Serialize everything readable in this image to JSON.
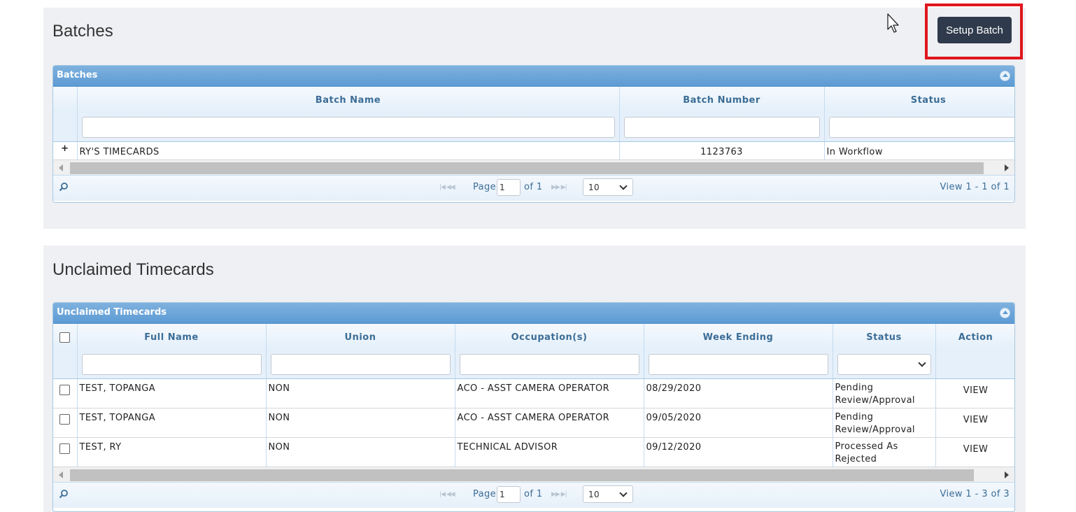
{
  "batches": {
    "title": "Batches",
    "setup_button": "Setup Batch",
    "grid": {
      "caption": "Batches",
      "columns": [
        "Batch Name",
        "Batch Number",
        "Status"
      ],
      "rows": [
        {
          "name": "RY'S TIMECARDS",
          "number": "1123763",
          "status": "In Workflow"
        }
      ],
      "pager": {
        "page_label": "Page",
        "page_value": "1",
        "of_label": "of 1",
        "page_size": "10",
        "view_summary": "View 1 - 1 of 1"
      }
    }
  },
  "unclaimed": {
    "title": "Unclaimed Timecards",
    "grid": {
      "caption": "Unclaimed Timecards",
      "columns": [
        "Full Name",
        "Union",
        "Occupation(s)",
        "Week Ending",
        "Status",
        "Action"
      ],
      "rows": [
        {
          "name": "TEST, TOPANGA",
          "union": "NON",
          "occupation": "ACO - ASST CAMERA OPERATOR",
          "week_ending": "08/29/2020",
          "status_line1": "Pending",
          "status_line2": "Review/Approval",
          "action": "VIEW"
        },
        {
          "name": "TEST, TOPANGA",
          "union": "NON",
          "occupation": "ACO - ASST CAMERA OPERATOR",
          "week_ending": "09/05/2020",
          "status_line1": "Pending",
          "status_line2": "Review/Approval",
          "action": "VIEW"
        },
        {
          "name": "TEST, RY",
          "union": "NON",
          "occupation": "TECHNICAL ADVISOR",
          "week_ending": "09/12/2020",
          "status_line1": "Processed As",
          "status_line2": "Rejected",
          "action": "VIEW"
        }
      ],
      "pager": {
        "page_label": "Page",
        "page_value": "1",
        "of_label": "of 1",
        "page_size": "10",
        "view_summary": "View 1 - 3 of 3"
      }
    }
  },
  "colors": {
    "accent_button": "#2f3b4c",
    "highlight_box": "#e0161e",
    "grid_header": "#5c9bd4",
    "link": "#2b7bb8"
  }
}
